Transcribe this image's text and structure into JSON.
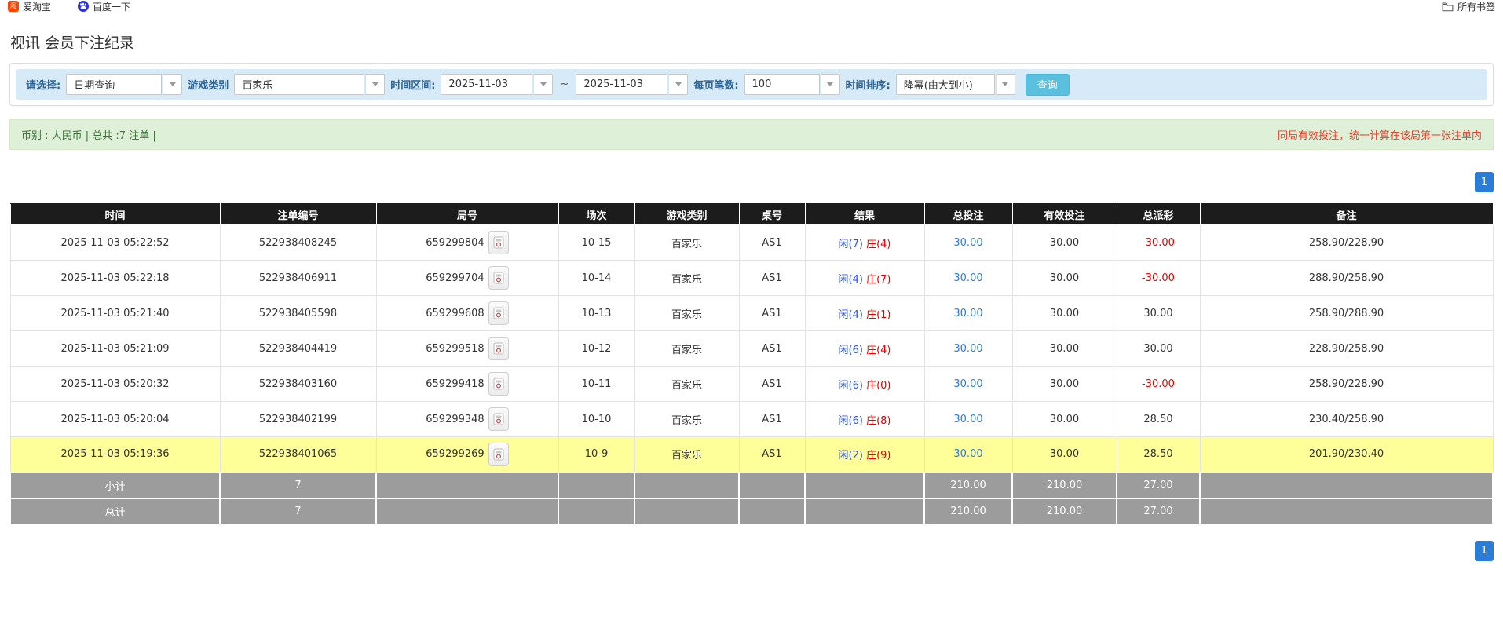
{
  "bookmarks_bar": {
    "items": [
      {
        "icon": "taobao-icon",
        "label": "爱淘宝"
      },
      {
        "icon": "baidu-icon",
        "label": "百度一下"
      }
    ],
    "all_bookmarks": {
      "icon": "folder-icon",
      "label": "所有书签"
    }
  },
  "page": {
    "title": "视讯 会员下注纪录"
  },
  "filters": {
    "select_label": "请选择:",
    "select_value": "日期查询",
    "game_type_label": "游戏类别",
    "game_type_value": "百家乐",
    "time_range_label": "时间区间:",
    "date_from": "2025-11-03",
    "range_separator": "~",
    "date_to": "2025-11-03",
    "page_size_label": "每页笔数:",
    "page_size_value": "100",
    "sort_label": "时间排序:",
    "sort_value": "降幂(由大到小)",
    "search_button": "查询"
  },
  "summary_bar": {
    "left_text": "币别 : 人民币 | 总共 :7 注单 |",
    "right_note": "同局有效投注，统一计算在该局第一张注单内"
  },
  "pagination": {
    "page": "1"
  },
  "table": {
    "headers": [
      "时间",
      "注单编号",
      "局号",
      "场次",
      "游戏类别",
      "桌号",
      "结果",
      "总投注",
      "有效投注",
      "总派彩",
      "备注"
    ],
    "rows": [
      {
        "time": "2025-11-03 05:22:52",
        "bet_id": "522938408245",
        "round_id": "659299804",
        "session": "10-15",
        "game": "百家乐",
        "table_no": "AS1",
        "result_player": "闲(7)",
        "result_banker": "庄(4)",
        "total_bet": "30.00",
        "valid_bet": "30.00",
        "payout": "-30.00",
        "note": "258.90/228.90",
        "highlighted": false
      },
      {
        "time": "2025-11-03 05:22:18",
        "bet_id": "522938406911",
        "round_id": "659299704",
        "session": "10-14",
        "game": "百家乐",
        "table_no": "AS1",
        "result_player": "闲(4)",
        "result_banker": "庄(7)",
        "total_bet": "30.00",
        "valid_bet": "30.00",
        "payout": "-30.00",
        "note": "288.90/258.90",
        "highlighted": false
      },
      {
        "time": "2025-11-03 05:21:40",
        "bet_id": "522938405598",
        "round_id": "659299608",
        "session": "10-13",
        "game": "百家乐",
        "table_no": "AS1",
        "result_player": "闲(4)",
        "result_banker": "庄(1)",
        "total_bet": "30.00",
        "valid_bet": "30.00",
        "payout": "30.00",
        "note": "258.90/288.90",
        "highlighted": false
      },
      {
        "time": "2025-11-03 05:21:09",
        "bet_id": "522938404419",
        "round_id": "659299518",
        "session": "10-12",
        "game": "百家乐",
        "table_no": "AS1",
        "result_player": "闲(6)",
        "result_banker": "庄(4)",
        "total_bet": "30.00",
        "valid_bet": "30.00",
        "payout": "30.00",
        "note": "228.90/258.90",
        "highlighted": false
      },
      {
        "time": "2025-11-03 05:20:32",
        "bet_id": "522938403160",
        "round_id": "659299418",
        "session": "10-11",
        "game": "百家乐",
        "table_no": "AS1",
        "result_player": "闲(6)",
        "result_banker": "庄(0)",
        "total_bet": "30.00",
        "valid_bet": "30.00",
        "payout": "-30.00",
        "note": "258.90/228.90",
        "highlighted": false
      },
      {
        "time": "2025-11-03 05:20:04",
        "bet_id": "522938402199",
        "round_id": "659299348",
        "session": "10-10",
        "game": "百家乐",
        "table_no": "AS1",
        "result_player": "闲(6)",
        "result_banker": "庄(8)",
        "total_bet": "30.00",
        "valid_bet": "30.00",
        "payout": "28.50",
        "note": "230.40/258.90",
        "highlighted": false
      },
      {
        "time": "2025-11-03 05:19:36",
        "bet_id": "522938401065",
        "round_id": "659299269",
        "session": "10-9",
        "game": "百家乐",
        "table_no": "AS1",
        "result_player": "闲(2)",
        "result_banker": "庄(9)",
        "total_bet": "30.00",
        "valid_bet": "30.00",
        "payout": "28.50",
        "note": "201.90/230.40",
        "highlighted": true
      }
    ],
    "subtotal": {
      "label": "小计",
      "count": "7",
      "total_bet": "210.00",
      "valid_bet": "210.00",
      "payout": "27.00"
    },
    "total": {
      "label": "总计",
      "count": "7",
      "total_bet": "210.00",
      "valid_bet": "210.00",
      "payout": "27.00"
    }
  },
  "colors": {
    "header_bg": "#1c1c1c",
    "filter_bar_bg": "#d7eaf7",
    "label_blue": "#2a6496",
    "search_button_bg": "#5bc0de",
    "success_bg": "#dff0d8",
    "success_text": "#3c763d",
    "warning_note_red": "#e8412c",
    "highlight_yellow": "#ffff99",
    "summary_gray": "#9c9c9c",
    "link_blue": "#2e7bd6",
    "player_blue": "#2f54eb",
    "banker_red": "#e80000",
    "pager_blue": "#2a7cd5"
  }
}
